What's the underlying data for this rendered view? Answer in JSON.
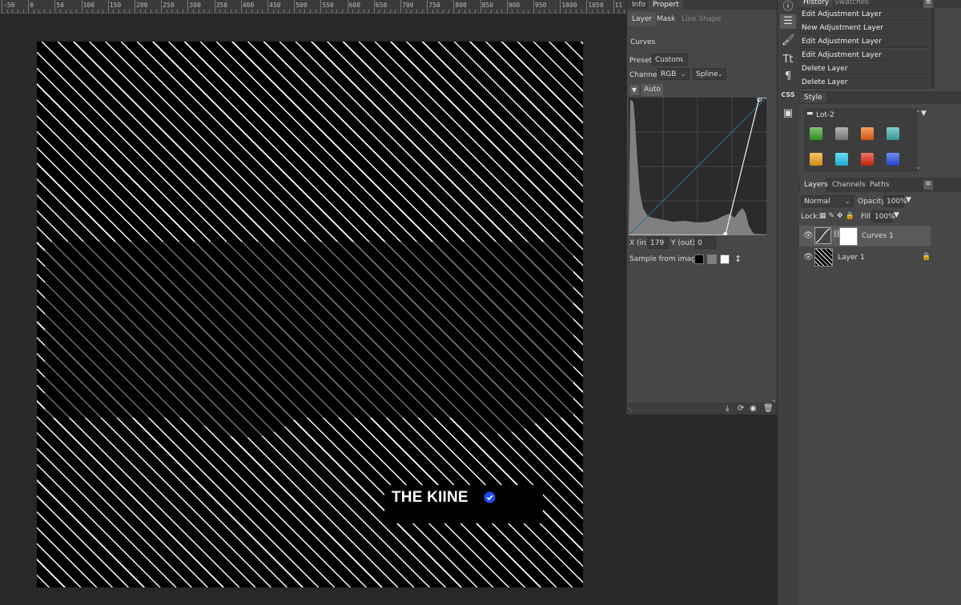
{
  "ruler": {
    "labels": [
      "-50",
      "0",
      "50",
      "100",
      "150",
      "200",
      "250",
      "300",
      "350",
      "400",
      "450",
      "500",
      "550",
      "600",
      "650",
      "700",
      "750",
      "800",
      "850",
      "900",
      "950",
      "1000",
      "1050",
      "11"
    ]
  },
  "canvas": {
    "badge_text": "THE KIINE",
    "colors": {
      "background": "#000000",
      "stripes": "#ffffff",
      "verified": "#1d4df0"
    }
  },
  "properties_panel": {
    "top_tabs": [
      "Info",
      "Propert"
    ],
    "sub_tabs": [
      "Layer",
      "Mask",
      "Live Shape"
    ],
    "title": "Curves",
    "preset_label": "Preset:",
    "preset_value": "Custom",
    "channel_label": "Channel:",
    "channel_value": "RGB",
    "interp_value": "Spline",
    "auto_label": "Auto",
    "x_label": "X (in):",
    "x_value": "179",
    "y_label": "Y (out):",
    "y_value": "0",
    "sample_label": "Sample from image:",
    "curve_points": [
      [
        0,
        0
      ],
      [
        179,
        0
      ],
      [
        242,
        255
      ],
      [
        255,
        255
      ]
    ]
  },
  "history": {
    "tabs": [
      "History",
      "Swatches"
    ],
    "items": [
      "Edit Adjustment Layer",
      "New Adjustment Layer",
      "Edit Adjustment Layer",
      "Edit Adjustment Layer",
      "Delete Layer",
      "Delete Layer"
    ]
  },
  "style": {
    "tab": "Style",
    "folder": "Lot-2",
    "swatches": [
      "#3fa52a",
      "#8a8a8a",
      "#f06a10",
      "#3fb1b1",
      "#f5a21a",
      "#20c8f0",
      "#e02a10",
      "#2850e8"
    ]
  },
  "layers": {
    "tabs": [
      "Layers",
      "Channels",
      "Paths"
    ],
    "blend_mode": "Normal",
    "opacity_label": "Opacity:",
    "opacity_value": "100%",
    "lock_label": "Lock:",
    "fill_label": "Fill:",
    "fill_value": "100%",
    "items": [
      {
        "name": "Curves 1",
        "visible": true,
        "selected": true
      },
      {
        "name": "Layer 1",
        "visible": true,
        "locked": true
      }
    ]
  },
  "toolstrip": {
    "css_label": "CSS"
  }
}
